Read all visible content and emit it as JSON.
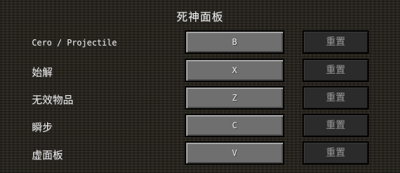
{
  "screen": {
    "title": "死神面板"
  },
  "controls": [
    {
      "label": "Cero / Projectile",
      "key": "B",
      "reset_label": "重置"
    },
    {
      "label": "始解",
      "key": "X",
      "reset_label": "重置"
    },
    {
      "label": "无效物品",
      "key": "Z",
      "reset_label": "重置"
    },
    {
      "label": "瞬步",
      "key": "C",
      "reset_label": "重置"
    },
    {
      "label": "虚面板",
      "key": "V",
      "reset_label": "重置"
    }
  ]
}
